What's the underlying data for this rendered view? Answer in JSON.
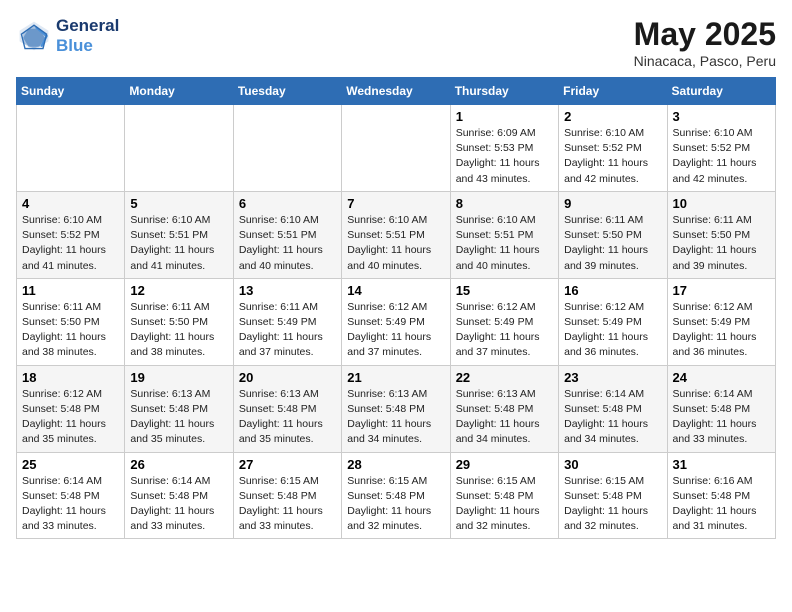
{
  "logo": {
    "line1": "General",
    "line2": "Blue"
  },
  "title": "May 2025",
  "subtitle": "Ninacaca, Pasco, Peru",
  "days_of_week": [
    "Sunday",
    "Monday",
    "Tuesday",
    "Wednesday",
    "Thursday",
    "Friday",
    "Saturday"
  ],
  "weeks": [
    [
      {
        "day": "",
        "info": ""
      },
      {
        "day": "",
        "info": ""
      },
      {
        "day": "",
        "info": ""
      },
      {
        "day": "",
        "info": ""
      },
      {
        "day": "1",
        "info": "Sunrise: 6:09 AM\nSunset: 5:53 PM\nDaylight: 11 hours and 43 minutes."
      },
      {
        "day": "2",
        "info": "Sunrise: 6:10 AM\nSunset: 5:52 PM\nDaylight: 11 hours and 42 minutes."
      },
      {
        "day": "3",
        "info": "Sunrise: 6:10 AM\nSunset: 5:52 PM\nDaylight: 11 hours and 42 minutes."
      }
    ],
    [
      {
        "day": "4",
        "info": "Sunrise: 6:10 AM\nSunset: 5:52 PM\nDaylight: 11 hours and 41 minutes."
      },
      {
        "day": "5",
        "info": "Sunrise: 6:10 AM\nSunset: 5:51 PM\nDaylight: 11 hours and 41 minutes."
      },
      {
        "day": "6",
        "info": "Sunrise: 6:10 AM\nSunset: 5:51 PM\nDaylight: 11 hours and 40 minutes."
      },
      {
        "day": "7",
        "info": "Sunrise: 6:10 AM\nSunset: 5:51 PM\nDaylight: 11 hours and 40 minutes."
      },
      {
        "day": "8",
        "info": "Sunrise: 6:10 AM\nSunset: 5:51 PM\nDaylight: 11 hours and 40 minutes."
      },
      {
        "day": "9",
        "info": "Sunrise: 6:11 AM\nSunset: 5:50 PM\nDaylight: 11 hours and 39 minutes."
      },
      {
        "day": "10",
        "info": "Sunrise: 6:11 AM\nSunset: 5:50 PM\nDaylight: 11 hours and 39 minutes."
      }
    ],
    [
      {
        "day": "11",
        "info": "Sunrise: 6:11 AM\nSunset: 5:50 PM\nDaylight: 11 hours and 38 minutes."
      },
      {
        "day": "12",
        "info": "Sunrise: 6:11 AM\nSunset: 5:50 PM\nDaylight: 11 hours and 38 minutes."
      },
      {
        "day": "13",
        "info": "Sunrise: 6:11 AM\nSunset: 5:49 PM\nDaylight: 11 hours and 37 minutes."
      },
      {
        "day": "14",
        "info": "Sunrise: 6:12 AM\nSunset: 5:49 PM\nDaylight: 11 hours and 37 minutes."
      },
      {
        "day": "15",
        "info": "Sunrise: 6:12 AM\nSunset: 5:49 PM\nDaylight: 11 hours and 37 minutes."
      },
      {
        "day": "16",
        "info": "Sunrise: 6:12 AM\nSunset: 5:49 PM\nDaylight: 11 hours and 36 minutes."
      },
      {
        "day": "17",
        "info": "Sunrise: 6:12 AM\nSunset: 5:49 PM\nDaylight: 11 hours and 36 minutes."
      }
    ],
    [
      {
        "day": "18",
        "info": "Sunrise: 6:12 AM\nSunset: 5:48 PM\nDaylight: 11 hours and 35 minutes."
      },
      {
        "day": "19",
        "info": "Sunrise: 6:13 AM\nSunset: 5:48 PM\nDaylight: 11 hours and 35 minutes."
      },
      {
        "day": "20",
        "info": "Sunrise: 6:13 AM\nSunset: 5:48 PM\nDaylight: 11 hours and 35 minutes."
      },
      {
        "day": "21",
        "info": "Sunrise: 6:13 AM\nSunset: 5:48 PM\nDaylight: 11 hours and 34 minutes."
      },
      {
        "day": "22",
        "info": "Sunrise: 6:13 AM\nSunset: 5:48 PM\nDaylight: 11 hours and 34 minutes."
      },
      {
        "day": "23",
        "info": "Sunrise: 6:14 AM\nSunset: 5:48 PM\nDaylight: 11 hours and 34 minutes."
      },
      {
        "day": "24",
        "info": "Sunrise: 6:14 AM\nSunset: 5:48 PM\nDaylight: 11 hours and 33 minutes."
      }
    ],
    [
      {
        "day": "25",
        "info": "Sunrise: 6:14 AM\nSunset: 5:48 PM\nDaylight: 11 hours and 33 minutes."
      },
      {
        "day": "26",
        "info": "Sunrise: 6:14 AM\nSunset: 5:48 PM\nDaylight: 11 hours and 33 minutes."
      },
      {
        "day": "27",
        "info": "Sunrise: 6:15 AM\nSunset: 5:48 PM\nDaylight: 11 hours and 33 minutes."
      },
      {
        "day": "28",
        "info": "Sunrise: 6:15 AM\nSunset: 5:48 PM\nDaylight: 11 hours and 32 minutes."
      },
      {
        "day": "29",
        "info": "Sunrise: 6:15 AM\nSunset: 5:48 PM\nDaylight: 11 hours and 32 minutes."
      },
      {
        "day": "30",
        "info": "Sunrise: 6:15 AM\nSunset: 5:48 PM\nDaylight: 11 hours and 32 minutes."
      },
      {
        "day": "31",
        "info": "Sunrise: 6:16 AM\nSunset: 5:48 PM\nDaylight: 11 hours and 31 minutes."
      }
    ]
  ]
}
